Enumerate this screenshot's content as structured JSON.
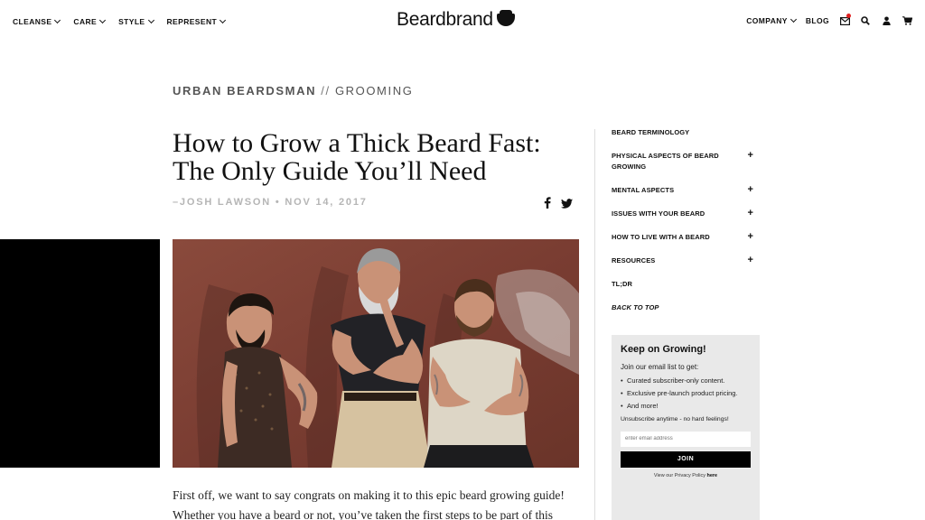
{
  "header": {
    "nav_left": [
      {
        "label": "CLEANSE"
      },
      {
        "label": "CARE"
      },
      {
        "label": "STYLE"
      },
      {
        "label": "REPRESENT"
      }
    ],
    "logo_text": "Beardbrand",
    "nav_right": {
      "company_label": "COMPANY",
      "blog_label": "BLOG"
    }
  },
  "article": {
    "kicker_category": "URBAN BEARDSMAN",
    "kicker_separator": "//",
    "kicker_subcategory": "GROOMING",
    "title": "How to Grow a Thick Beard Fast: The Only Guide You’ll Need",
    "byline": "–JOSH LAWSON • NOV 14, 2017",
    "body_intro": "First off, we want to say congrats on making it to this epic beard growing guide! Whether you have a beard or not, you’ve taken the first steps to be part of this"
  },
  "toc": {
    "items": [
      {
        "label": "BEARD TERMINOLOGY",
        "expand": ""
      },
      {
        "label": "PHYSICAL ASPECTS OF BEARD GROWING",
        "expand": "+"
      },
      {
        "label": "MENTAL ASPECTS",
        "expand": "+"
      },
      {
        "label": "ISSUES WITH YOUR BEARD",
        "expand": "+"
      },
      {
        "label": "HOW TO LIVE WITH A BEARD",
        "expand": "+"
      },
      {
        "label": "RESOURCES",
        "expand": "+"
      },
      {
        "label": "TL;DR",
        "expand": ""
      },
      {
        "label": "BACK TO TOP",
        "expand": ""
      }
    ]
  },
  "newsletter": {
    "title": "Keep on Growing!",
    "intro": "Join our email list to get:",
    "bullets": [
      "Curated subscriber-only content.",
      "Exclusive pre-launch product pricing.",
      "And more!"
    ],
    "unsubscribe": "Unsubscribe anytime - no hard feelings!",
    "email_placeholder": "enter email address",
    "join_label": "JOIN",
    "privacy_prefix": "View our Privacy Policy",
    "privacy_link": "here"
  },
  "colors": {
    "accent_dot": "#e02020",
    "byline_gray": "#b5b5b5",
    "newsletter_bg": "#e9e9e9"
  }
}
